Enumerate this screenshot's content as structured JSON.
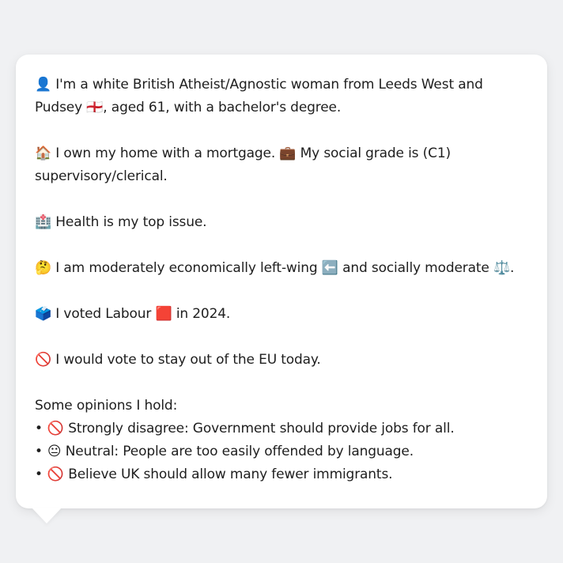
{
  "profile": {
    "identity": {
      "icon": "👤",
      "text": "I'm a white British Atheist/Agnostic woman from Leeds West and Pudsey",
      "flag": "🏴󠁧󠁢󠁥󠁮󠁧󠁿",
      "text2": ", aged 61, with a bachelor's degree."
    },
    "housing": {
      "icon": "🏠",
      "text": "I own my home with a mortgage.",
      "icon2": "💼",
      "text2": "My social grade is (C1) supervisory/clerical."
    },
    "issue": {
      "icon": "🏥",
      "text": "Health is my top issue."
    },
    "ideology": {
      "icon": "🤔",
      "text": "I am moderately economically left-wing",
      "icon2": "⬅️",
      "text2": "and socially moderate",
      "icon3": "⚖️",
      "text3": "."
    },
    "vote": {
      "icon": "🗳️",
      "text": "I voted Labour",
      "icon2": "🟥",
      "text2": "in 2024."
    },
    "eu": {
      "icon": "🚫",
      "text": "I would vote to stay out of the EU today."
    },
    "opinions": {
      "heading": "Some opinions I hold:",
      "items": [
        {
          "bullet": "•",
          "icon": "🚫",
          "text": "Strongly disagree: Government should provide jobs for all."
        },
        {
          "bullet": "•",
          "icon": "😐",
          "text": "Neutral: People are too easily offended by language."
        },
        {
          "bullet": "•",
          "icon": "🚫",
          "text": "Believe UK should allow many fewer immigrants."
        }
      ]
    }
  }
}
